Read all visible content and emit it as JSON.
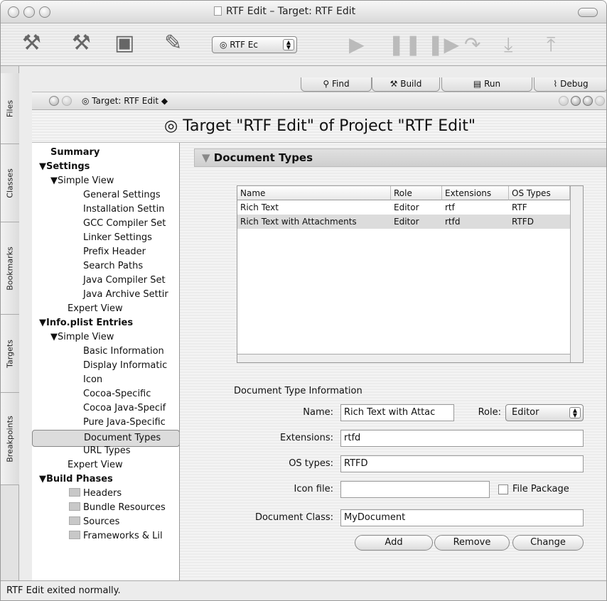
{
  "window": {
    "title": "RTF Edit – Target: RTF Edit"
  },
  "toolbar": {
    "target_selector": "RTF Ec"
  },
  "top_tabs": [
    "Find",
    "Build",
    "Run",
    "Debug"
  ],
  "side_tabs": [
    "Files",
    "Classes",
    "Bookmarks",
    "Targets",
    "Breakpoints"
  ],
  "nav": {
    "target_label": "Target: RTF Edit ◆"
  },
  "heading": "Target \"RTF Edit\" of Project \"RTF Edit\"",
  "outline": {
    "items": [
      {
        "label": "Summary"
      },
      {
        "label": "Settings"
      },
      {
        "label": "Simple View"
      },
      {
        "label": "General Settings"
      },
      {
        "label": "Installation Settin"
      },
      {
        "label": "GCC Compiler Set"
      },
      {
        "label": "Linker Settings"
      },
      {
        "label": "Prefix Header"
      },
      {
        "label": "Search Paths"
      },
      {
        "label": "Java Compiler Set"
      },
      {
        "label": "Java Archive Settir"
      },
      {
        "label": "Expert View"
      },
      {
        "label": "Info.plist Entries"
      },
      {
        "label": "Simple View"
      },
      {
        "label": "Basic Information"
      },
      {
        "label": "Display Informatic"
      },
      {
        "label": "Icon"
      },
      {
        "label": "Cocoa-Specific"
      },
      {
        "label": "Cocoa Java-Specif"
      },
      {
        "label": "Pure Java-Specific"
      },
      {
        "label": "Document Types"
      },
      {
        "label": "URL Types"
      },
      {
        "label": "Expert View"
      },
      {
        "label": "Build Phases"
      },
      {
        "label": "Headers"
      },
      {
        "label": "Bundle Resources"
      },
      {
        "label": "Sources"
      },
      {
        "label": "Frameworks & Lil"
      }
    ]
  },
  "section": {
    "title": "Document Types"
  },
  "doc_table": {
    "columns": [
      "Name",
      "Role",
      "Extensions",
      "OS Types"
    ],
    "rows": [
      [
        "Rich Text",
        "Editor",
        "rtf",
        "RTF"
      ],
      [
        "Rich Text with Attachments",
        "Editor",
        "rtfd",
        "RTFD"
      ]
    ]
  },
  "form": {
    "group_label": "Document Type Information",
    "name_label": "Name:",
    "name_value": "Rich Text with Attac",
    "role_label": "Role:",
    "role_value": "Editor",
    "extensions_label": "Extensions:",
    "extensions_value": "rtfd",
    "os_types_label": "OS types:",
    "os_types_value": "RTFD",
    "icon_file_label": "Icon file:",
    "icon_file_value": "",
    "file_package_label": "File Package",
    "doc_class_label": "Document Class:",
    "doc_class_value": "MyDocument",
    "add": "Add",
    "remove": "Remove",
    "change": "Change"
  },
  "status": "RTF Edit exited normally."
}
